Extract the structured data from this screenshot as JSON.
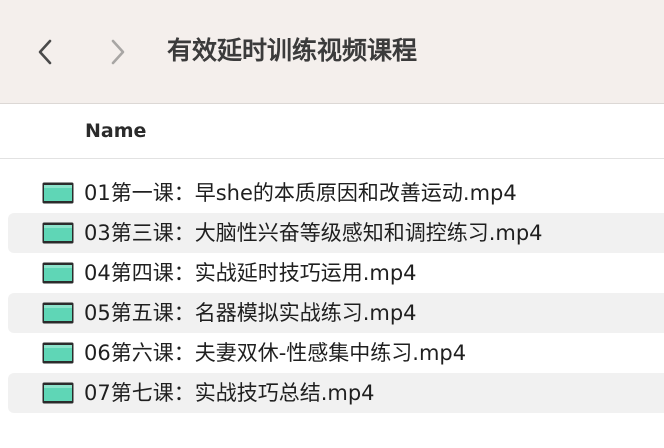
{
  "window": {
    "title": "有效延时训练视频课程"
  },
  "navigation": {
    "back_icon": "chevron-left-icon",
    "forward_icon": "chevron-right-icon"
  },
  "columns": {
    "name_label": "Name"
  },
  "files": [
    {
      "name": "01第一课：早she的本质原因和改善运动.mp4",
      "icon": "video-file-icon"
    },
    {
      "name": "03第三课：大脑性兴奋等级感知和调控练习.mp4",
      "icon": "video-file-icon"
    },
    {
      "name": "04第四课：实战延时技巧运用.mp4",
      "icon": "video-file-icon"
    },
    {
      "name": "05第五课：名器模拟实战练习.mp4",
      "icon": "video-file-icon"
    },
    {
      "name": "06第六课：夫妻双休-性感集中练习.mp4",
      "icon": "video-file-icon"
    },
    {
      "name": "07第七课：实战技巧总结.mp4",
      "icon": "video-file-icon"
    }
  ],
  "colors": {
    "titlebar_bg": "#f4efec",
    "alt_row_bg": "#f1f1f1",
    "icon_fill": "#5fd6b6"
  }
}
